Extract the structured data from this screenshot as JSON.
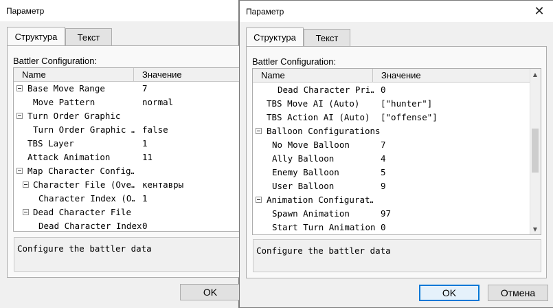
{
  "left_window": {
    "title": "Параметр",
    "tabs": [
      "Структура",
      "Текст"
    ],
    "section_label": "Battler Configuration:",
    "columns": [
      "Name",
      "Значение"
    ],
    "rows": [
      {
        "name": "Base Move Range",
        "value": "7"
      },
      {
        "name": "Move Pattern",
        "value": "normal"
      },
      {
        "name": "Turn Order Graphic",
        "value": ""
      },
      {
        "name": "Turn Order Graphic …",
        "value": "false"
      },
      {
        "name": "TBS Layer",
        "value": "1"
      },
      {
        "name": "Attack Animation",
        "value": "11"
      },
      {
        "name": "Map Character Config…",
        "value": ""
      },
      {
        "name": "Character File (Ove…",
        "value": "кентавры"
      },
      {
        "name": "Character Index (O…",
        "value": "1"
      },
      {
        "name": "Dead Character File",
        "value": ""
      },
      {
        "name": "Dead Character Index",
        "value": "0"
      }
    ],
    "description": "Configure the battler data",
    "ok_label": "OK"
  },
  "right_window": {
    "title": "Параметр",
    "close_icon": "close-icon",
    "tabs": [
      "Структура",
      "Текст"
    ],
    "section_label": "Battler Configuration:",
    "columns": [
      "Name",
      "Значение"
    ],
    "rows": [
      {
        "name": "Dead Character Pri…",
        "value": "0"
      },
      {
        "name": "TBS Move AI (Auto)",
        "value": "[\"hunter\"]"
      },
      {
        "name": "TBS Action AI (Auto)",
        "value": "[\"offense\"]"
      },
      {
        "name": "Balloon Configurations",
        "value": ""
      },
      {
        "name": "No Move Balloon",
        "value": "7"
      },
      {
        "name": "Ally Balloon",
        "value": "4"
      },
      {
        "name": "Enemy Balloon",
        "value": "5"
      },
      {
        "name": "User Balloon",
        "value": "9"
      },
      {
        "name": "Animation Configurat…",
        "value": ""
      },
      {
        "name": "Spawn Animation",
        "value": "97"
      },
      {
        "name": "Start Turn Animation",
        "value": "0"
      }
    ],
    "description": "Configure the battler data",
    "ok_label": "OK",
    "cancel_label": "Отмена"
  }
}
